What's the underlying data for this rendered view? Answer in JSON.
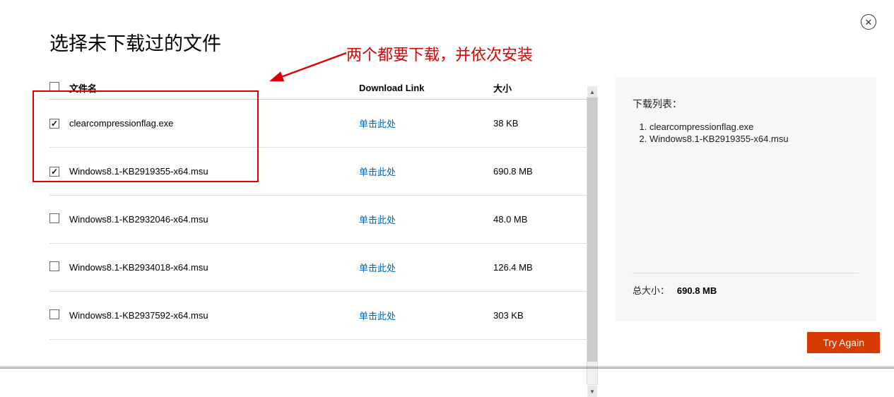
{
  "title": "选择未下载过的文件",
  "annotation_text": "两个都要下载，并依次安装",
  "headers": {
    "filename": "文件名",
    "download_link": "Download Link",
    "size": "大小"
  },
  "rows": [
    {
      "checked": true,
      "name": "clearcompressionflag.exe",
      "link": "单击此处",
      "size": "38 KB"
    },
    {
      "checked": true,
      "name": "Windows8.1-KB2919355-x64.msu",
      "link": "单击此处",
      "size": "690.8 MB"
    },
    {
      "checked": false,
      "name": "Windows8.1-KB2932046-x64.msu",
      "link": "单击此处",
      "size": "48.0 MB"
    },
    {
      "checked": false,
      "name": "Windows8.1-KB2934018-x64.msu",
      "link": "单击此处",
      "size": "126.4 MB"
    },
    {
      "checked": false,
      "name": "Windows8.1-KB2937592-x64.msu",
      "link": "单击此处",
      "size": "303 KB"
    }
  ],
  "download_list": {
    "title": "下载列表：",
    "items": [
      "clearcompressionflag.exe",
      "Windows8.1-KB2919355-x64.msu"
    ]
  },
  "total": {
    "label": "总大小：",
    "value": "690.8 MB"
  },
  "try_again_label": "Try Again"
}
